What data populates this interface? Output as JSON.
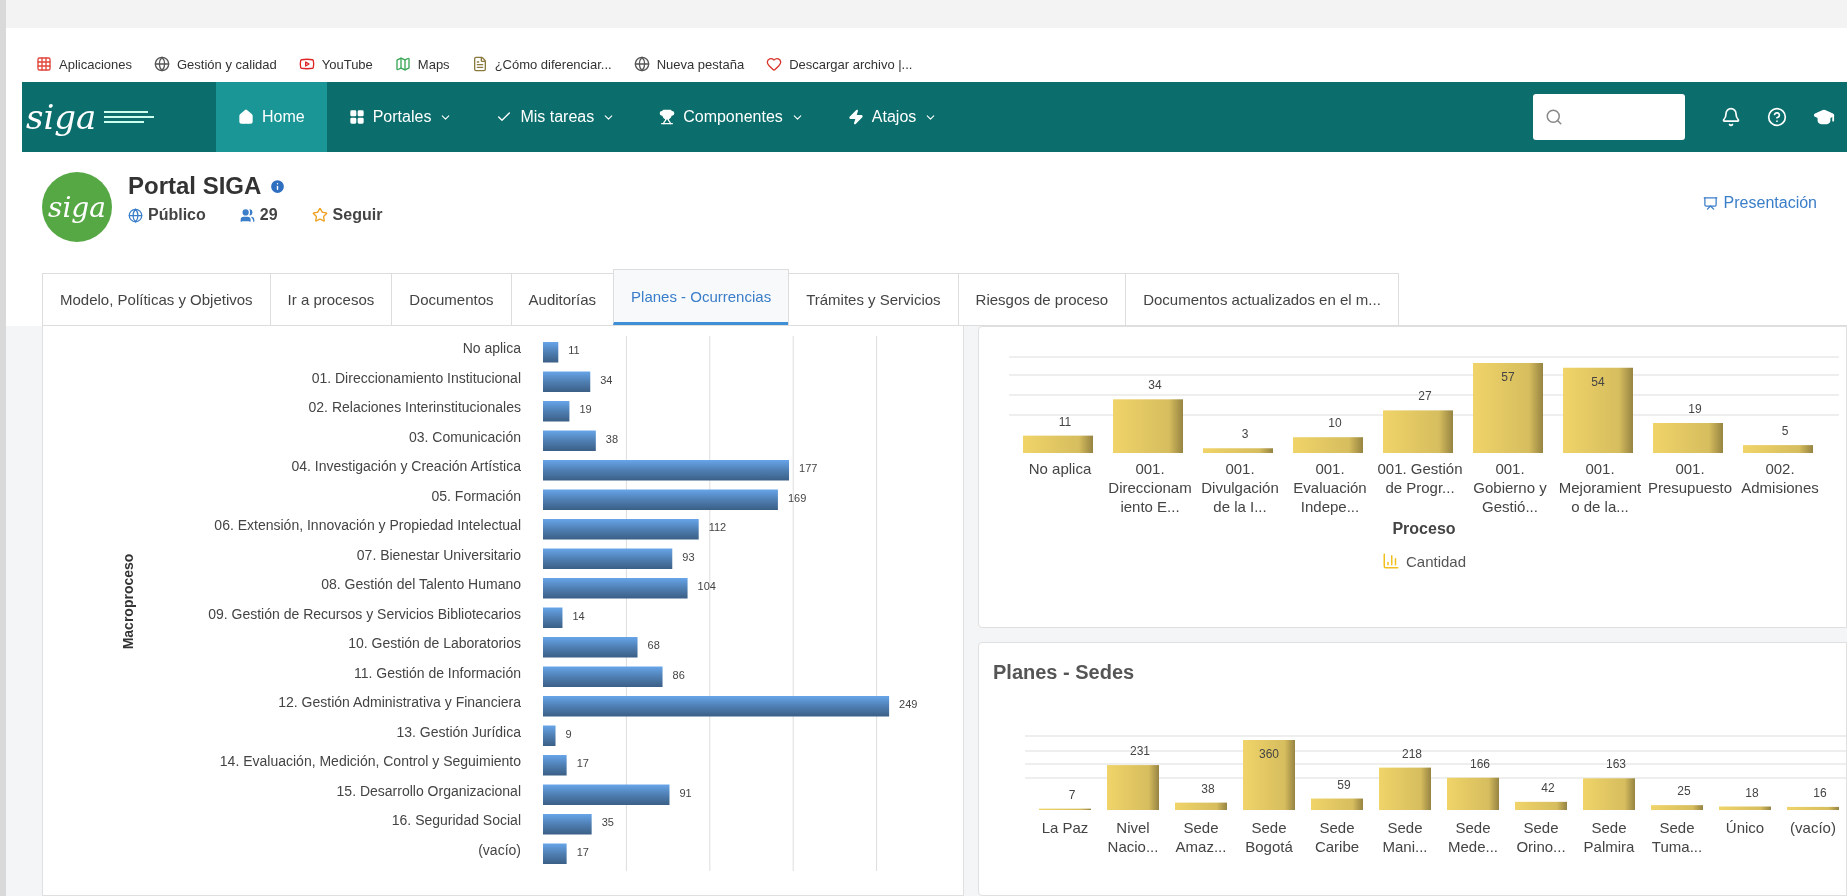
{
  "bookmarks": [
    {
      "label": "Aplicaciones",
      "kind": "apps"
    },
    {
      "label": "Gestión y calidad",
      "kind": "globe"
    },
    {
      "label": "YouTube",
      "kind": "video"
    },
    {
      "label": "Maps",
      "kind": "map"
    },
    {
      "label": "¿Cómo diferenciar...",
      "kind": "doc"
    },
    {
      "label": "Nueva pestaña",
      "kind": "globe"
    },
    {
      "label": "Descargar archivo |...",
      "kind": "heart"
    }
  ],
  "nav": {
    "logo": "siga",
    "items": [
      {
        "label": "Home",
        "kind": "home",
        "selected": true,
        "dropdown": false
      },
      {
        "label": "Portales",
        "kind": "grid",
        "selected": false,
        "dropdown": true
      },
      {
        "label": "Mis tareas",
        "kind": "check",
        "selected": false,
        "dropdown": true
      },
      {
        "label": "Componentes",
        "kind": "trophy",
        "selected": false,
        "dropdown": true
      },
      {
        "label": "Atajos",
        "kind": "bolt",
        "selected": false,
        "dropdown": true
      }
    ]
  },
  "portal": {
    "logo": "siga",
    "title": "Portal SIGA",
    "visibility": "Público",
    "members": "29",
    "follow": "Seguir",
    "presentation": "Presentación"
  },
  "tabs": [
    {
      "label": "Modelo, Políticas y Objetivos",
      "selected": false
    },
    {
      "label": "Ir a procesos",
      "selected": false
    },
    {
      "label": "Documentos",
      "selected": false
    },
    {
      "label": "Auditorías",
      "selected": false
    },
    {
      "label": "Planes - Ocurrencias",
      "selected": true
    },
    {
      "label": "Trámites y Servicios",
      "selected": false
    },
    {
      "label": "Riesgos de proceso",
      "selected": false
    },
    {
      "label": "Documentos actualizados en el m...",
      "selected": false
    }
  ],
  "macroproceso_panel": {
    "chart_data": {
      "type": "bar",
      "orientation": "horizontal",
      "ylabel": "Macroproceso",
      "data_labels": true,
      "categories": [
        "No aplica",
        "01. Direccionamiento Institucional",
        "02. Relaciones Interinstitucionales",
        "03. Comunicación",
        "04. Investigación y Creación Artística",
        "05. Formación",
        "06. Extensión, Innovación y Propiedad Intelectual",
        "07. Bienestar Universitario",
        "08. Gestión del Talento Humano",
        "09. Gestión de Recursos y Servicios Bibliotecarios",
        "10. Gestión de Laboratorios",
        "11. Gestión de Información",
        "12. Gestión Administrativa y Financiera",
        "13. Gestión Jurídica",
        "14. Evaluación, Medición, Control y Seguimiento",
        "15. Desarrollo Organizacional",
        "16. Seguridad Social",
        "(vacío)"
      ],
      "values": [
        11,
        34,
        19,
        38,
        177,
        169,
        112,
        93,
        104,
        14,
        68,
        86,
        249,
        9,
        17,
        91,
        35,
        17
      ]
    }
  },
  "proceso_panel": {
    "chart_data": {
      "type": "bar",
      "xlabel": "Proceso",
      "data_labels": true,
      "categories": [
        "No aplica",
        "001. Direccionamiento E...",
        "001. Divulgación de la I...",
        "001. Evaluación Indepe...",
        "001. Gestión de Progr...",
        "001. Gobierno y Gestió...",
        "001. Mejoramiento de la...",
        "001. Presupuesto",
        "002. Admisiones"
      ],
      "series": [
        {
          "name": "Cantidad",
          "color": "#d6bd5e",
          "values": [
            11,
            34,
            3,
            10,
            27,
            57,
            54,
            19,
            5
          ]
        }
      ]
    }
  },
  "sedes_panel": {
    "title": "Planes - Sedes",
    "chart_data": {
      "type": "bar",
      "data_labels": true,
      "categories": [
        "La Paz",
        "Nivel Nacio...",
        "Sede Amaz...",
        "Sede Bogotá",
        "Sede Caribe",
        "Sede Mani...",
        "Sede Mede...",
        "Sede Orino...",
        "Sede Palmira",
        "Sede Tuma...",
        "Único",
        "(vacío)"
      ],
      "values": [
        7,
        231,
        38,
        360,
        59,
        218,
        166,
        42,
        163,
        25,
        18,
        16
      ]
    }
  }
}
